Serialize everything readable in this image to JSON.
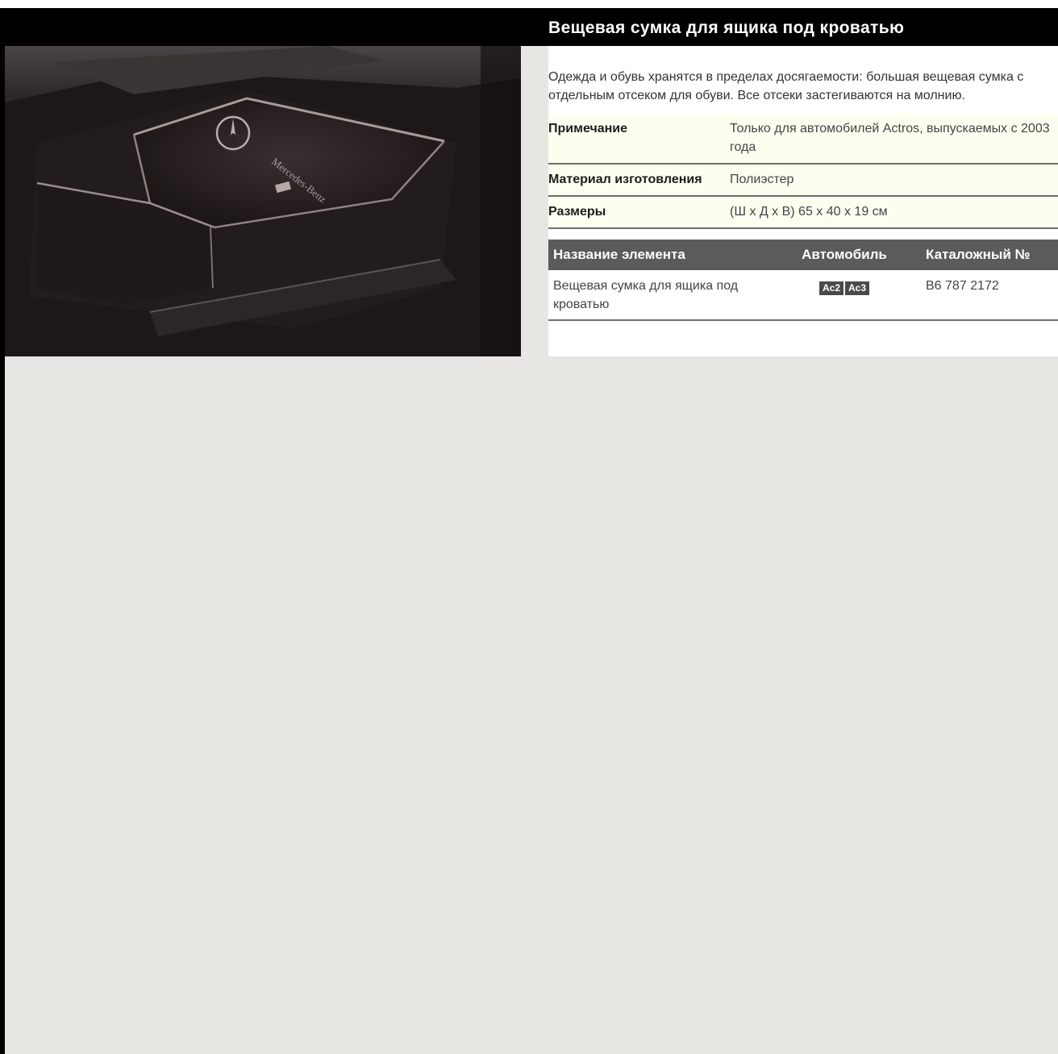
{
  "title": "Вещевая сумка для ящика под кроватью",
  "description": "Одежда и обувь хранятся в пределах досягаемости: большая вещевая сумка с отдельным отсеком для обуви. Все отсеки застегиваются на молнию.",
  "photo": {
    "subject": "bag-in-underbed-drawer",
    "logo": "mercedes-star",
    "logo_text": "Mercedes-Benz"
  },
  "specs": [
    {
      "label": "Примечание",
      "value": "Только для автомобилей Actros, выпускаемых с 2003 года"
    },
    {
      "label": "Материал изготовления",
      "value": "Полиэстер"
    },
    {
      "label": "Размеры",
      "value": "(Ш х Д х В) 65 х 40 х 19 см"
    }
  ],
  "parts_table": {
    "headers": {
      "name": "Название элемента",
      "vehicle": "Автомобиль",
      "part_number": "Каталожный №"
    },
    "rows": [
      {
        "name": "Вещевая сумка для ящика под кроватью",
        "vehicles": [
          "Ac2",
          "Ac3"
        ],
        "part_number": "B6 787 2172"
      }
    ]
  },
  "colors": {
    "title_bar": "#000000",
    "spec_row_bg": "#fefef0",
    "table_header_bg": "#5b5b5b",
    "badge_bg": "#4a4a4a",
    "page_bg": "#e7e6e2"
  }
}
